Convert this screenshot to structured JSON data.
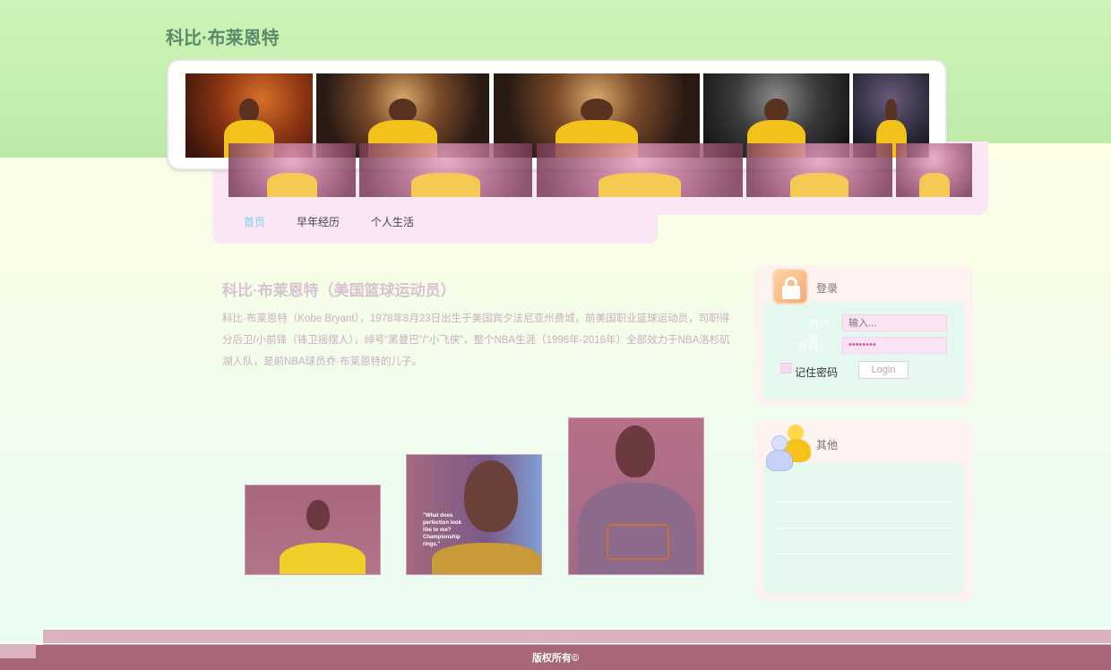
{
  "site": {
    "title": "科比·布莱恩特"
  },
  "nav": [
    {
      "label": "首页",
      "active": true
    },
    {
      "label": "早年经历",
      "active": false
    },
    {
      "label": "个人生活",
      "active": false
    }
  ],
  "article": {
    "title": "科比·布莱恩特（美国篮球运动员）",
    "body": "科比·布莱恩特（Kobe Bryant），1978年8月23日出生于美国宾夕法尼亚州费城，前美国职业篮球运动员，司职得分后卫/小前锋（锋卫摇摆人），绰号“黑曼巴”/“小飞侠”，整个NBA生涯（1996年-2016年）全部效力于NBA洛杉矶湖人队，是前NBA球员乔·布莱恩特的儿子。"
  },
  "gallery": {
    "photo2_caption": "\"What does perfection look like to me? Championship rings.\""
  },
  "login": {
    "heading": "登录",
    "user_label": "用户名：",
    "pass_label": "密码：",
    "user_placeholder": "输入...",
    "pass_value": "••••••••",
    "remember_label": "记住密码",
    "button_label": "Login"
  },
  "other": {
    "heading": "其他"
  },
  "footer": {
    "text": "版权所有©"
  },
  "colors": {
    "top_band": "#c4efae",
    "nav_active": "#7ccff0",
    "footer": "#a86679",
    "panel": "#fbe6f6"
  },
  "icons": {
    "login": "lock-icon",
    "other": "people-icon"
  }
}
